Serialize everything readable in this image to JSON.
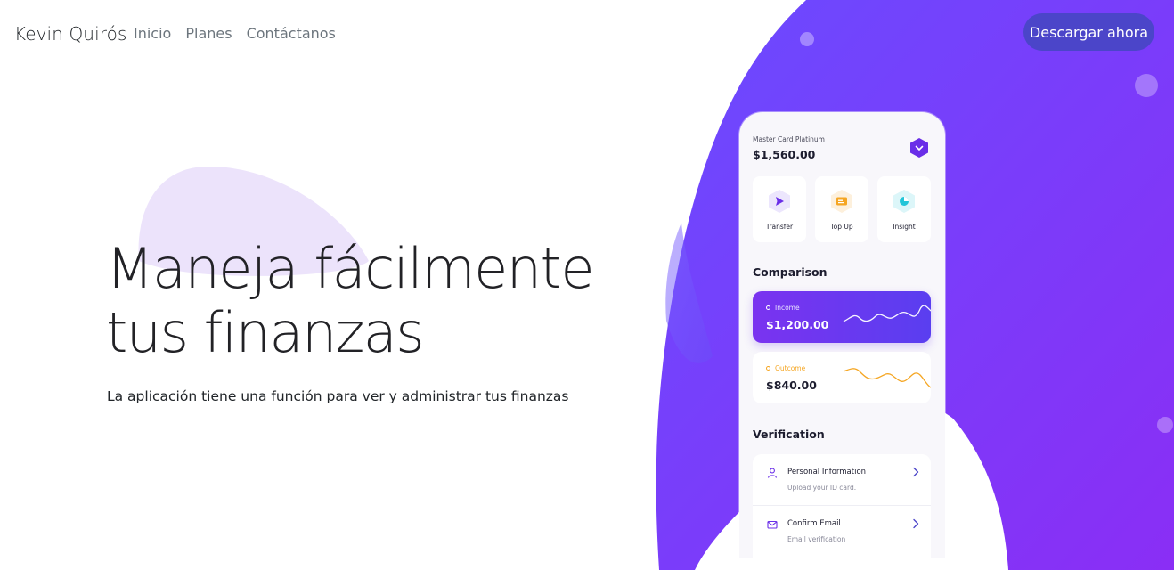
{
  "navbar": {
    "brand": "Kevin Quirós",
    "links": [
      "Inicio",
      "Planes",
      "Contáctanos"
    ],
    "cta": "Descargar ahora"
  },
  "hero": {
    "title_line1": "Maneja fácilmente",
    "title_line2": "tus finanzas",
    "subtitle": "La aplicación tiene una función para ver y administrar tus finanzas"
  },
  "phone": {
    "card_name": "Master Card Platinum",
    "balance": "$1,560.00",
    "actions": [
      {
        "label": "Transfer",
        "icon": "transfer-icon"
      },
      {
        "label": "Top Up",
        "icon": "card-icon"
      },
      {
        "label": "Insight",
        "icon": "pie-chart-icon"
      }
    ],
    "comparison": {
      "title": "Comparison",
      "income": {
        "label": "Income",
        "value": "$1,200.00"
      },
      "outcome": {
        "label": "Outcome",
        "value": "$840.00"
      }
    },
    "verification": {
      "title": "Verification",
      "items": [
        {
          "title": "Personal Information",
          "subtitle": "Upload your ID card.",
          "icon": "user-icon"
        },
        {
          "title": "Confirm Email",
          "subtitle": "Email verification",
          "icon": "mail-icon"
        }
      ]
    }
  },
  "colors": {
    "accent": "#4b45c9",
    "purple": "#7a33f0",
    "outcome": "#f5a623",
    "teal": "#22c5d8"
  }
}
